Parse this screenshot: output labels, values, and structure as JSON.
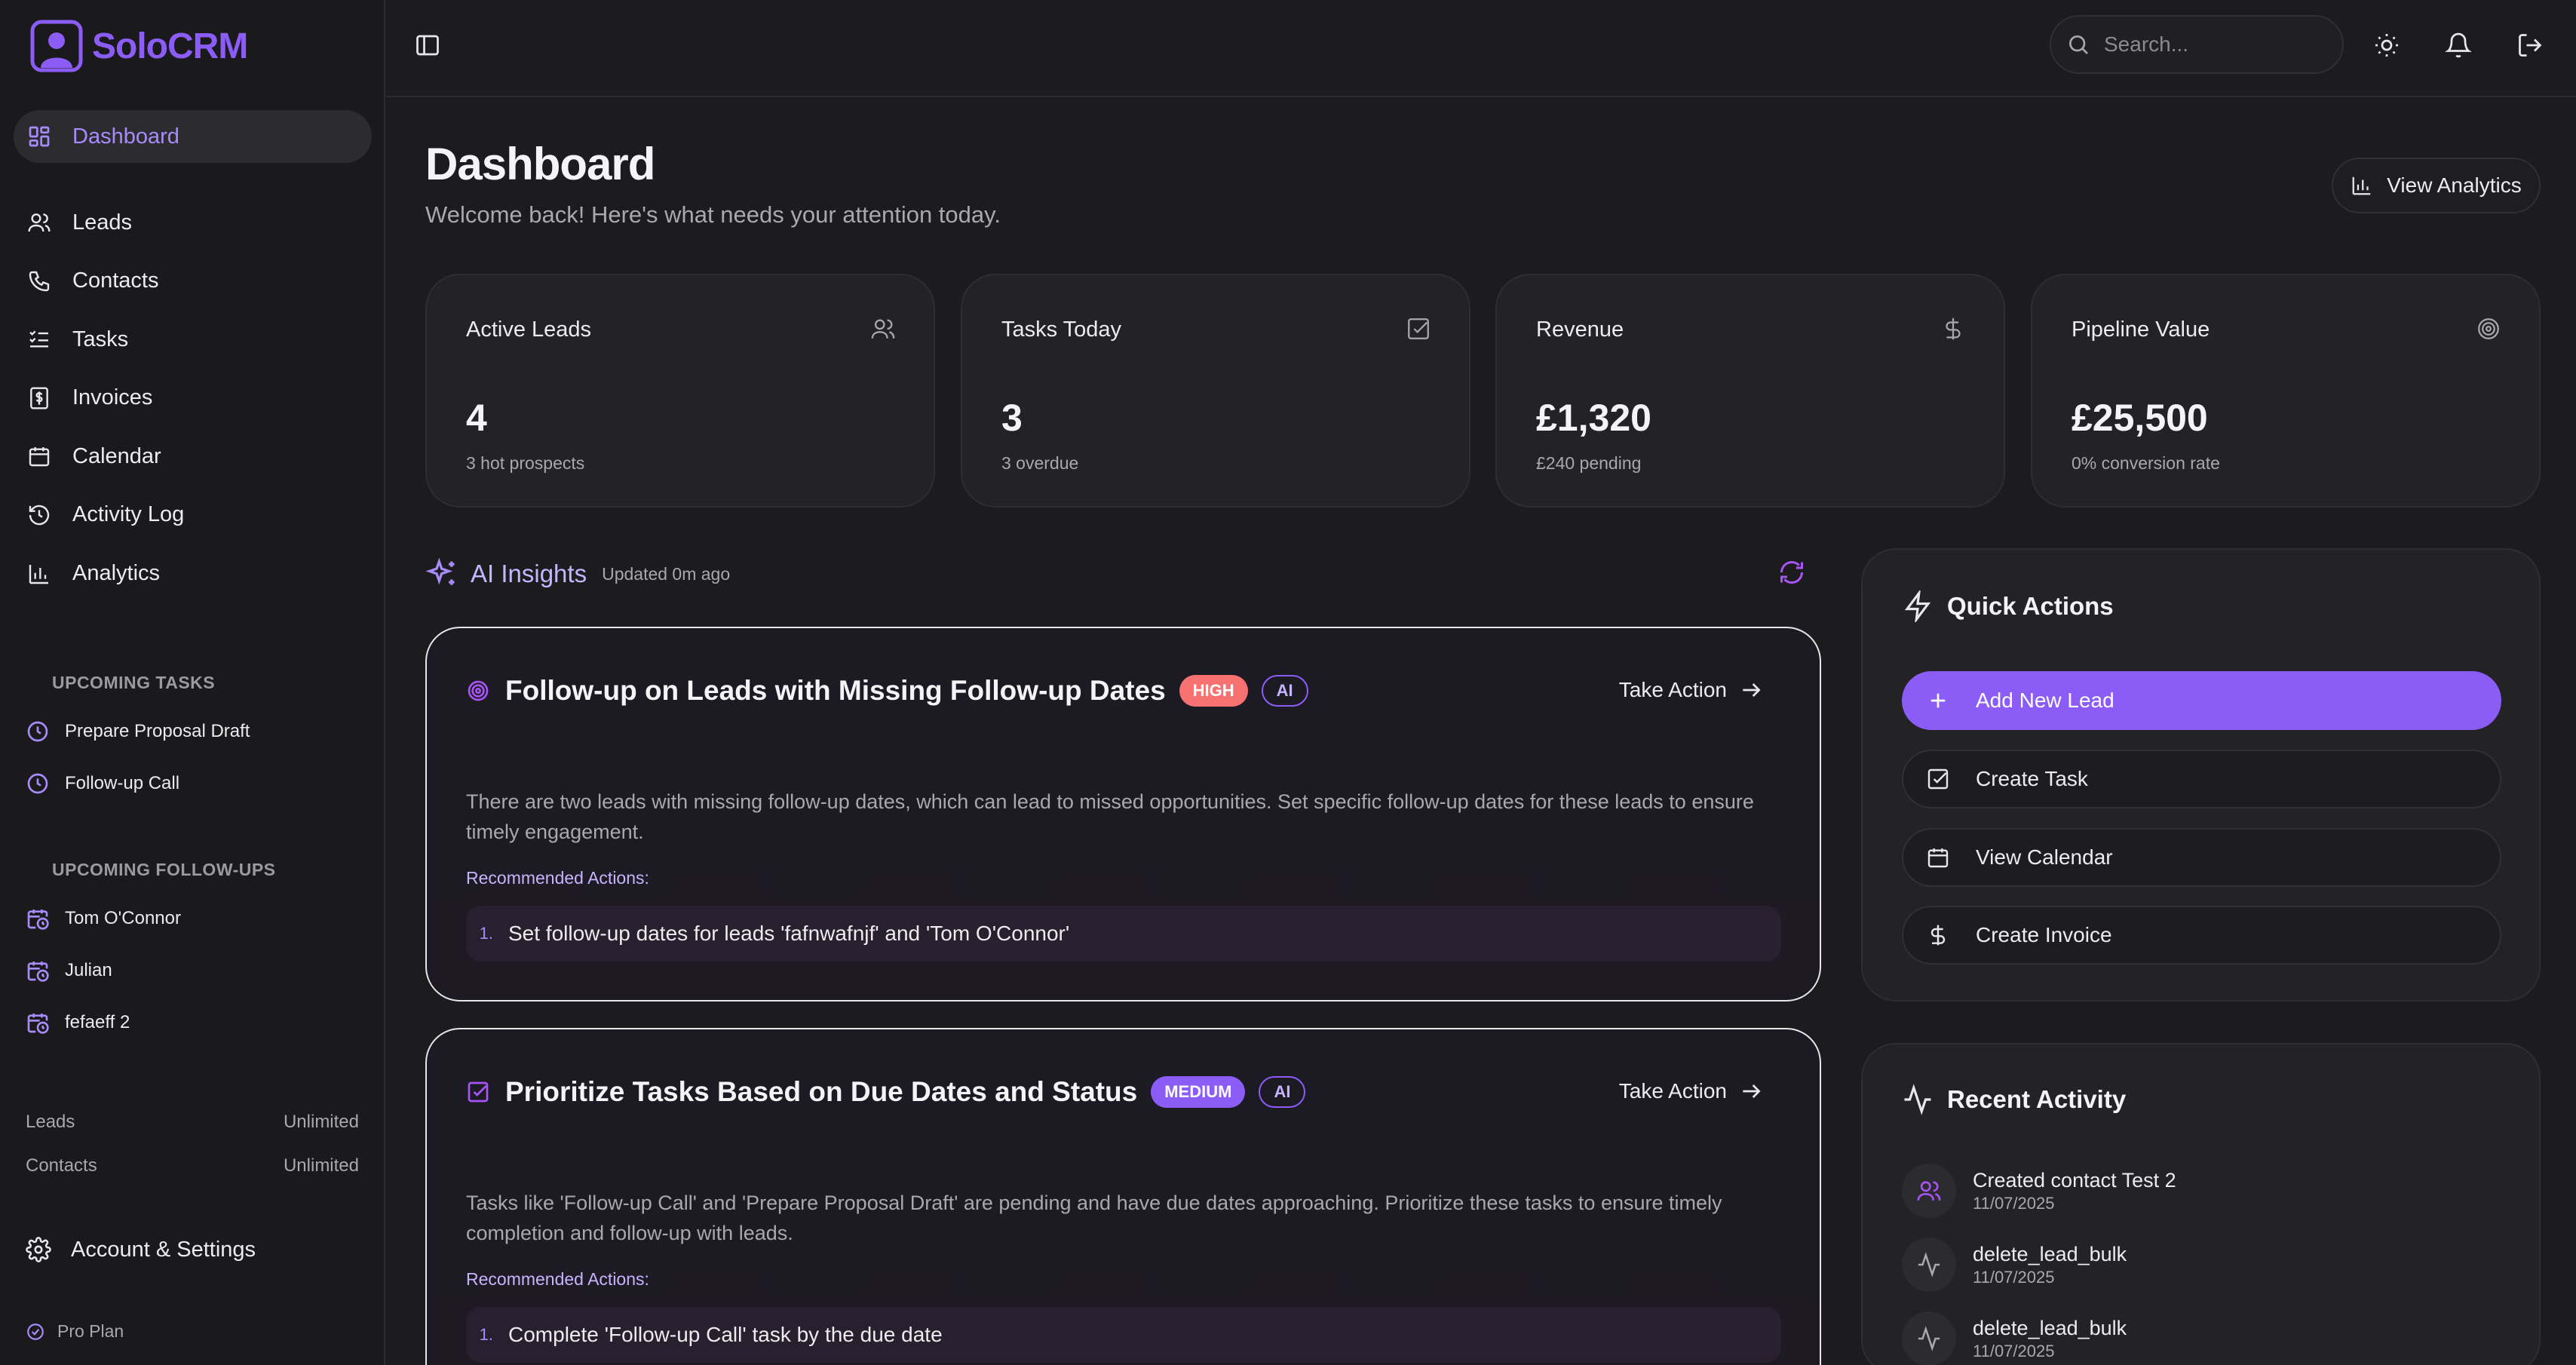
{
  "app": {
    "name": "SoloCRM"
  },
  "sidebar": {
    "nav": [
      {
        "label": "Dashboard",
        "icon": "dashboard-icon"
      },
      {
        "label": "Leads",
        "icon": "users-icon"
      },
      {
        "label": "Contacts",
        "icon": "phone-icon"
      },
      {
        "label": "Tasks",
        "icon": "list-check-icon"
      },
      {
        "label": "Invoices",
        "icon": "dollar-icon"
      },
      {
        "label": "Calendar",
        "icon": "calendar-icon"
      },
      {
        "label": "Activity Log",
        "icon": "history-icon"
      },
      {
        "label": "Analytics",
        "icon": "bar-chart-icon"
      }
    ],
    "upcoming_tasks": {
      "title": "UPCOMING TASKS",
      "items": [
        "Prepare Proposal Draft",
        "Follow-up Call"
      ]
    },
    "upcoming_followups": {
      "title": "UPCOMING FOLLOW-UPS",
      "items": [
        "Tom O'Connor",
        "Julian",
        "fefaeff 2"
      ]
    },
    "usage": [
      {
        "label": "Leads",
        "value": "Unlimited"
      },
      {
        "label": "Contacts",
        "value": "Unlimited"
      }
    ],
    "account_label": "Account & Settings",
    "plan_label": "Pro Plan"
  },
  "topbar": {
    "search_placeholder": "Search..."
  },
  "header": {
    "title": "Dashboard",
    "subtitle": "Welcome back! Here's what needs your attention today.",
    "analytics_button": "View Analytics"
  },
  "stats": [
    {
      "label": "Active Leads",
      "value": "4",
      "sub": "3 hot prospects",
      "icon": "users-icon"
    },
    {
      "label": "Tasks Today",
      "value": "3",
      "sub": "3 overdue",
      "icon": "checkbox-icon"
    },
    {
      "label": "Revenue",
      "value": "£1,320",
      "sub": "£240 pending",
      "icon": "dollar-icon"
    },
    {
      "label": "Pipeline Value",
      "value": "£25,500",
      "sub": "0% conversion rate",
      "icon": "target-icon"
    }
  ],
  "ai_insights": {
    "title": "AI Insights",
    "updated": "Updated 0m ago",
    "action_label": "Take Action",
    "rec_label": "Recommended Actions:",
    "cards": [
      {
        "title": "Follow-up on Leads with Missing Follow-up Dates",
        "priority": "HIGH",
        "tag": "AI",
        "description": "There are two leads with missing follow-up dates, which can lead to missed opportunities. Set specific follow-up dates for these leads to ensure timely engagement.",
        "actions": [
          {
            "num": "1.",
            "text": "Set follow-up dates for leads 'fafnwafnjf' and 'Tom O'Connor'"
          }
        ]
      },
      {
        "title": "Prioritize Tasks Based on Due Dates and Status",
        "priority": "MEDIUM",
        "tag": "AI",
        "description": "Tasks like 'Follow-up Call' and 'Prepare Proposal Draft' are pending and have due dates approaching. Prioritize these tasks to ensure timely completion and follow-up with leads.",
        "actions": [
          {
            "num": "1.",
            "text": "Complete 'Follow-up Call' task by the due date"
          }
        ]
      }
    ]
  },
  "quick_actions": {
    "title": "Quick Actions",
    "items": [
      {
        "label": "Add New Lead",
        "icon": "plus-icon"
      },
      {
        "label": "Create Task",
        "icon": "checkbox-icon"
      },
      {
        "label": "View Calendar",
        "icon": "calendar-icon"
      },
      {
        "label": "Create Invoice",
        "icon": "dollar-icon"
      }
    ]
  },
  "recent_activity": {
    "title": "Recent Activity",
    "items": [
      {
        "title": "Created contact Test 2",
        "date": "11/07/2025",
        "icon": "users-icon"
      },
      {
        "title": "delete_lead_bulk",
        "date": "11/07/2025",
        "icon": "activity-icon"
      },
      {
        "title": "delete_lead_bulk",
        "date": "11/07/2025",
        "icon": "activity-icon"
      }
    ]
  },
  "colors": {
    "accent": "#8b5cf6",
    "accent_light": "#a78bfa",
    "high": "#f87171",
    "background": "#1c1c1e"
  }
}
